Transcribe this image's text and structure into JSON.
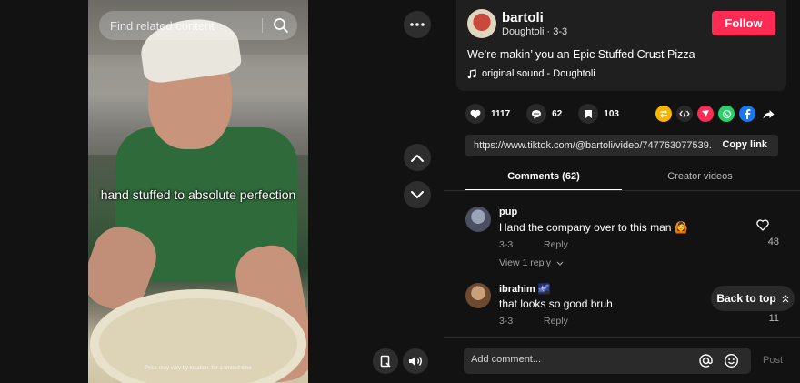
{
  "search": {
    "placeholder": "Find related content"
  },
  "video": {
    "caption": "hand stuffed to absolute perfection",
    "price_note": "Price may vary by location; for a limited time"
  },
  "author": {
    "username": "bartoli",
    "subtitle": "Doughtoli · 3-3",
    "follow_label": "Follow"
  },
  "post": {
    "description": "We’re makin’ you an Epic Stuffed Crust Pizza",
    "sound": "original sound - Doughtoli"
  },
  "stats": {
    "likes": "1117",
    "comments": "62",
    "saves": "103"
  },
  "share": {
    "link": "https://www.tiktok.com/@bartoli/video/747763077539...",
    "copy_label": "Copy link",
    "icons": [
      "repost-icon",
      "embed-icon",
      "send-icon",
      "whatsapp-icon",
      "facebook-icon",
      "share-arrow-icon"
    ],
    "colors": {
      "repost": "#f8b500",
      "embed": "#2a2a2a",
      "send": "#fe2c55",
      "whatsapp": "#25d366",
      "facebook": "#1877f2"
    }
  },
  "tabs": [
    {
      "label": "Comments (62)",
      "active": true
    },
    {
      "label": "Creator videos",
      "active": false
    }
  ],
  "comments": [
    {
      "user": "pup",
      "text": "Hand the company over to this man 🙆",
      "date": "3-3",
      "reply_label": "Reply",
      "likes": "48",
      "view_replies": "View 1 reply"
    },
    {
      "user": "ibrahim 🌌",
      "text": "that looks so good bruh",
      "date": "3-3",
      "reply_label": "Reply",
      "likes": "11"
    }
  ],
  "back_to_top": "Back to top",
  "composer": {
    "placeholder": "Add comment...",
    "post_label": "Post"
  },
  "accent": "#fe2c55"
}
